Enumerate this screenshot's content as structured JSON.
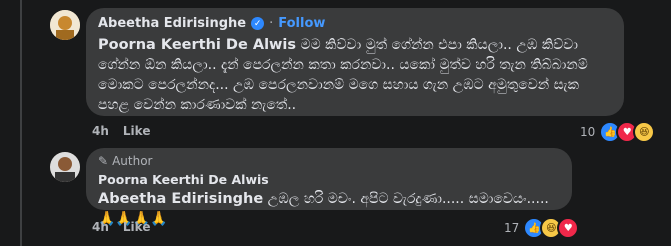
{
  "comment1": {
    "author": "Abeetha Edirisinghe",
    "follow_label": "Follow",
    "dot": "·",
    "mention": "Poorna Keerthi De Alwis",
    "text": "මම කිව්වා මුත් ගේන්න එපා කියලා.. උඹ කිව්වා ගේන්න ඕන කියලා.. දැන් පෙරලන්න කතා කරනවා.. යකෝ මුත්ව හරි තැන තිබ්බානම් මොකට පෙරලන්නද... උඹ පෙරලනවානම් මගෙ සහාය ගැන උඹට අමුතුවෙන් සැක පහළ වෙන්න කාරණාවක් නැතේ..",
    "time": "4h",
    "like_label": "Like",
    "reaction_count": "10"
  },
  "comment2": {
    "badge_label": "Author",
    "author": "Poorna Keerthi De Alwis",
    "mention": "Abeetha Edirisinghe",
    "text": "උඹල හරි මචං. අපිට වැරදුණා..... සමාවෙයං.....🙏🙏🙏🙏",
    "time": "4h",
    "like_label": "Like",
    "reaction_count": "17"
  },
  "icons": {
    "verified": "verified-check-icon",
    "pencil": "pencil-icon",
    "like": "like-reaction-icon",
    "love": "love-reaction-icon",
    "haha": "haha-reaction-icon"
  }
}
